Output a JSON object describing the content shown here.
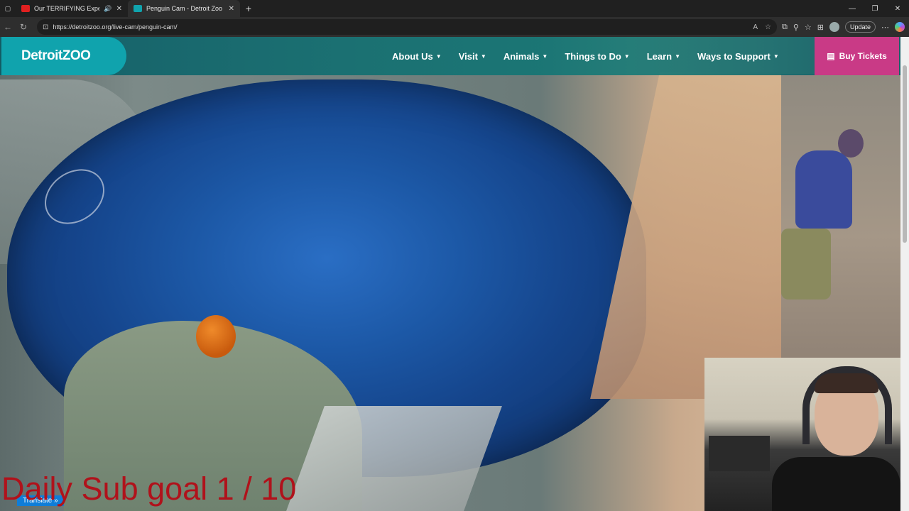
{
  "browser": {
    "tabs": [
      {
        "title": "Our TERRIFYING Experience",
        "favicon": "youtube-icon",
        "favicon_color": "#e02020",
        "active": false
      },
      {
        "title": "Penguin Cam - Detroit Zoo",
        "favicon": "detroit-zoo-icon",
        "favicon_color": "#10a3ad",
        "active": true
      }
    ],
    "url": "https://detroitzoo.org/live-cam/penguin-cam/",
    "update_label": "Update"
  },
  "site": {
    "logo": "DetroitZOO",
    "nav": [
      {
        "label": "About Us"
      },
      {
        "label": "Visit"
      },
      {
        "label": "Animals"
      },
      {
        "label": "Things to Do"
      },
      {
        "label": "Learn"
      },
      {
        "label": "Ways to Support"
      }
    ],
    "cta": "Buy Tickets",
    "brand_color": "#10a3ad",
    "cta_color": "#c93a86"
  },
  "overlay": {
    "sub_goal": "Daily Sub goal 1 / 10",
    "sub_goal_color": "#b0121b",
    "translate_label": "Translate »"
  }
}
